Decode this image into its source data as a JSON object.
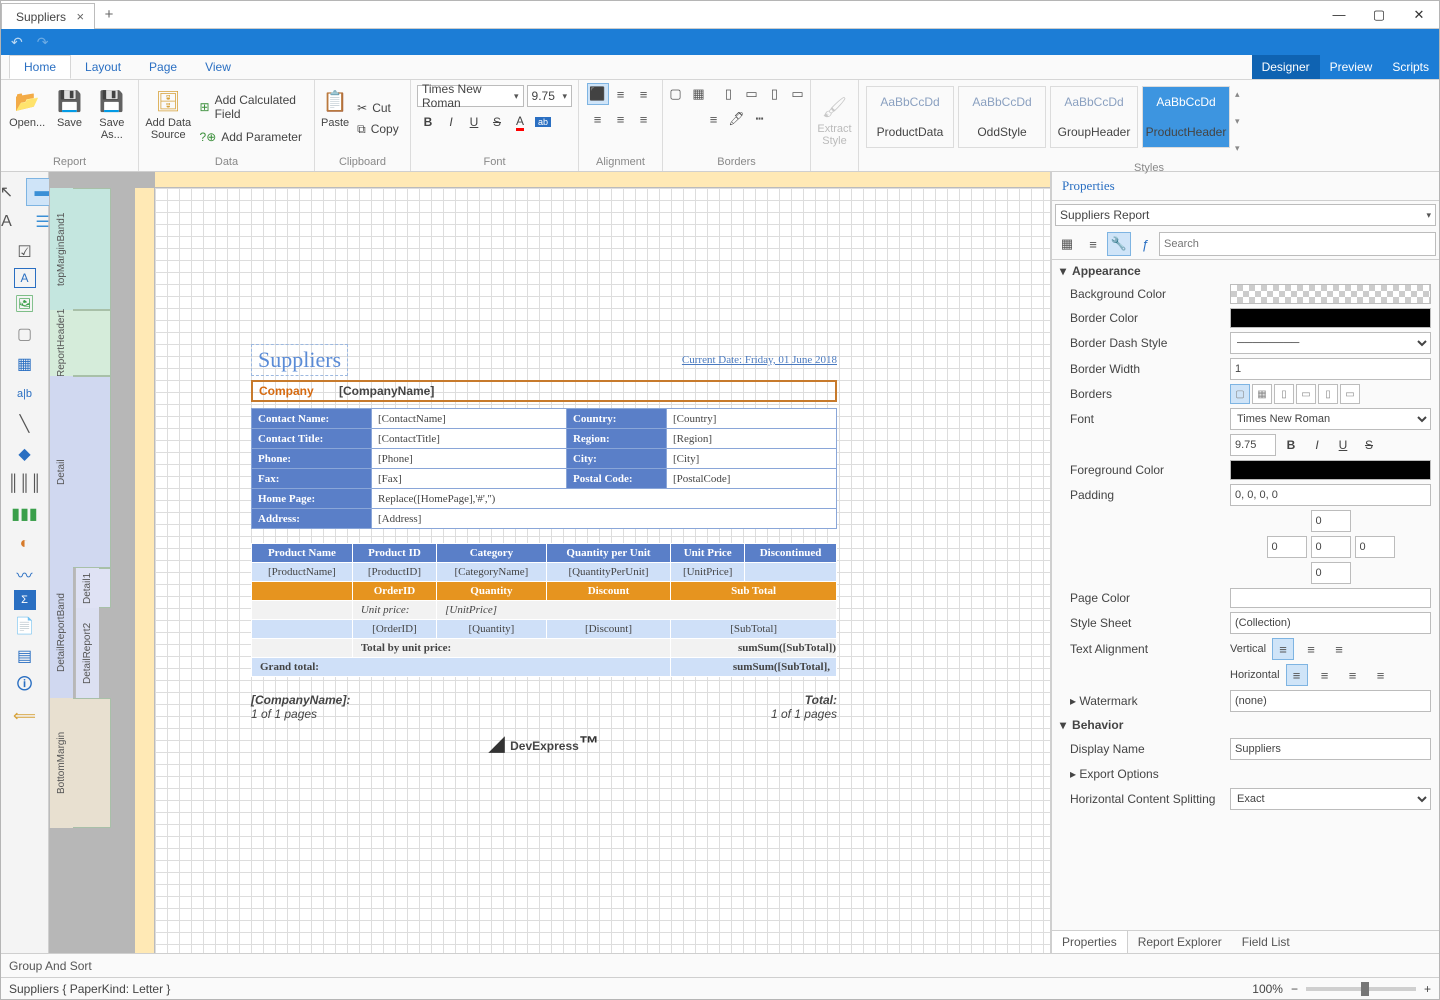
{
  "tab_title": "Suppliers",
  "ribbon_tabs": {
    "home": "Home",
    "layout": "Layout",
    "page": "Page",
    "view": "View",
    "designer": "Designer",
    "preview": "Preview",
    "scripts": "Scripts"
  },
  "groups": {
    "report": "Report",
    "data": "Data",
    "clipboard": "Clipboard",
    "font": "Font",
    "alignment": "Alignment",
    "borders": "Borders",
    "styles": "Styles"
  },
  "buttons": {
    "open": "Open...",
    "save": "Save",
    "saveas": "Save\nAs...",
    "adddata": "Add Data\nSource",
    "calcfield": "Add Calculated Field",
    "param": "Add Parameter",
    "paste": "Paste",
    "cut": "Cut",
    "copy": "Copy",
    "extract": "Extract\nStyle"
  },
  "font": {
    "name": "Times New Roman",
    "size": "9.75"
  },
  "style_boxes": [
    "ProductData",
    "OddStyle",
    "GroupHeader",
    "ProductHeader"
  ],
  "style_preview": "AaBbCcDd",
  "report": {
    "title": "Suppliers",
    "date_label": "Current Date:  Friday, 01 June 2018",
    "company_k": "Company",
    "company_v": "[CompanyName]",
    "rows": [
      [
        "Contact Name:",
        "[ContactName]",
        "Country:",
        "[Country]"
      ],
      [
        "Contact Title:",
        "[ContactTitle]",
        "Region:",
        "[Region]"
      ],
      [
        "Phone:",
        "[Phone]",
        "City:",
        "[City]"
      ],
      [
        "Fax:",
        "[Fax]",
        "Postal Code:",
        "[PostalCode]"
      ],
      [
        "Home Page:",
        "Replace([HomePage],'#','')",
        "",
        ""
      ],
      [
        "Address:",
        "[Address]",
        "",
        ""
      ]
    ],
    "gridhdr": [
      "Product Name",
      "Product ID",
      "Category",
      "Quantity per Unit",
      "Unit Price",
      "Discontinued"
    ],
    "gridrow": [
      "[ProductName]",
      "[ProductID]",
      "[CategoryName]",
      "[QuantityPerUnit]",
      "[UnitPrice]",
      ""
    ],
    "ordhdr": [
      "OrderID",
      "Quantity",
      "Discount",
      "Sub Total"
    ],
    "uprice_k": "Unit price:",
    "uprice_v": "[UnitPrice]",
    "ordrow": [
      "[OrderID]",
      "[Quantity]",
      "[Discount]",
      "[SubTotal]"
    ],
    "totbyunit": "Total by unit price:",
    "totbyunit_v": "sumSum([SubTotal])",
    "grand": "Grand total:",
    "grand_v": "sumSum([SubTotal],",
    "footc": "[CompanyName]:",
    "foot_pages": "1 of 1 pages",
    "foot_total": "Total:",
    "logo": "DevExpress"
  },
  "bands": {
    "top": "topMarginBand1",
    "rh": "ReportHeader1",
    "detail": "Detail",
    "d1": "Detail1",
    "drb": "DetailReportBand",
    "dr2": "DetailReport2",
    "bm": "BottomMargin"
  },
  "props": {
    "title": "Properties",
    "target": "Suppliers  Report",
    "search": "Search",
    "cat_app": "Appearance",
    "cat_beh": "Behavior",
    "bg": "Background Color",
    "bc": "Border Color",
    "bds": "Border Dash Style",
    "bw": "Border Width",
    "brd": "Borders",
    "font": "Font",
    "fg": "Foreground Color",
    "pad": "Padding",
    "pc": "Page Color",
    "ss": "Style Sheet",
    "ta": "Text Alignment",
    "wm": "Watermark",
    "dn": "Display Name",
    "eo": "Export Options",
    "hcs": "Horizontal Content Splitting",
    "bw_v": "1",
    "font_v": "Times New Roman",
    "size_v": "9.75",
    "pad_v": "0, 0, 0, 0",
    "pad0": "0",
    "ss_v": "(Collection)",
    "wm_v": "(none)",
    "dn_v": "Suppliers",
    "hcs_v": "Exact",
    "ta_v": "Vertical",
    "ta_h": "Horizontal",
    "tabs": [
      "Properties",
      "Report Explorer",
      "Field List"
    ]
  },
  "bottom": "Group And Sort",
  "status": "Suppliers { PaperKind: Letter }",
  "zoom": "100%"
}
